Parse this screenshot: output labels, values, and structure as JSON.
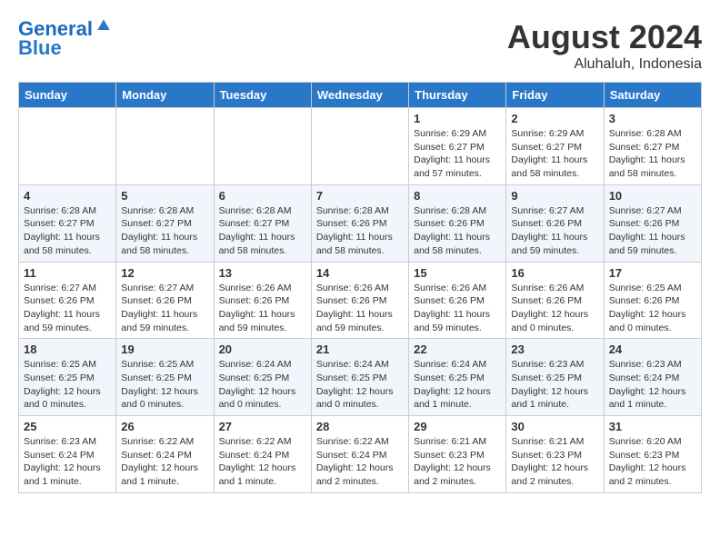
{
  "header": {
    "logo_line1": "General",
    "logo_line2": "Blue",
    "month_year": "August 2024",
    "location": "Aluhaluh, Indonesia"
  },
  "weekdays": [
    "Sunday",
    "Monday",
    "Tuesday",
    "Wednesday",
    "Thursday",
    "Friday",
    "Saturday"
  ],
  "weeks": [
    [
      {
        "day": "",
        "info": ""
      },
      {
        "day": "",
        "info": ""
      },
      {
        "day": "",
        "info": ""
      },
      {
        "day": "",
        "info": ""
      },
      {
        "day": "1",
        "info": "Sunrise: 6:29 AM\nSunset: 6:27 PM\nDaylight: 11 hours\nand 57 minutes."
      },
      {
        "day": "2",
        "info": "Sunrise: 6:29 AM\nSunset: 6:27 PM\nDaylight: 11 hours\nand 58 minutes."
      },
      {
        "day": "3",
        "info": "Sunrise: 6:28 AM\nSunset: 6:27 PM\nDaylight: 11 hours\nand 58 minutes."
      }
    ],
    [
      {
        "day": "4",
        "info": "Sunrise: 6:28 AM\nSunset: 6:27 PM\nDaylight: 11 hours\nand 58 minutes."
      },
      {
        "day": "5",
        "info": "Sunrise: 6:28 AM\nSunset: 6:27 PM\nDaylight: 11 hours\nand 58 minutes."
      },
      {
        "day": "6",
        "info": "Sunrise: 6:28 AM\nSunset: 6:27 PM\nDaylight: 11 hours\nand 58 minutes."
      },
      {
        "day": "7",
        "info": "Sunrise: 6:28 AM\nSunset: 6:26 PM\nDaylight: 11 hours\nand 58 minutes."
      },
      {
        "day": "8",
        "info": "Sunrise: 6:28 AM\nSunset: 6:26 PM\nDaylight: 11 hours\nand 58 minutes."
      },
      {
        "day": "9",
        "info": "Sunrise: 6:27 AM\nSunset: 6:26 PM\nDaylight: 11 hours\nand 59 minutes."
      },
      {
        "day": "10",
        "info": "Sunrise: 6:27 AM\nSunset: 6:26 PM\nDaylight: 11 hours\nand 59 minutes."
      }
    ],
    [
      {
        "day": "11",
        "info": "Sunrise: 6:27 AM\nSunset: 6:26 PM\nDaylight: 11 hours\nand 59 minutes."
      },
      {
        "day": "12",
        "info": "Sunrise: 6:27 AM\nSunset: 6:26 PM\nDaylight: 11 hours\nand 59 minutes."
      },
      {
        "day": "13",
        "info": "Sunrise: 6:26 AM\nSunset: 6:26 PM\nDaylight: 11 hours\nand 59 minutes."
      },
      {
        "day": "14",
        "info": "Sunrise: 6:26 AM\nSunset: 6:26 PM\nDaylight: 11 hours\nand 59 minutes."
      },
      {
        "day": "15",
        "info": "Sunrise: 6:26 AM\nSunset: 6:26 PM\nDaylight: 11 hours\nand 59 minutes."
      },
      {
        "day": "16",
        "info": "Sunrise: 6:26 AM\nSunset: 6:26 PM\nDaylight: 12 hours\nand 0 minutes."
      },
      {
        "day": "17",
        "info": "Sunrise: 6:25 AM\nSunset: 6:26 PM\nDaylight: 12 hours\nand 0 minutes."
      }
    ],
    [
      {
        "day": "18",
        "info": "Sunrise: 6:25 AM\nSunset: 6:25 PM\nDaylight: 12 hours\nand 0 minutes."
      },
      {
        "day": "19",
        "info": "Sunrise: 6:25 AM\nSunset: 6:25 PM\nDaylight: 12 hours\nand 0 minutes."
      },
      {
        "day": "20",
        "info": "Sunrise: 6:24 AM\nSunset: 6:25 PM\nDaylight: 12 hours\nand 0 minutes."
      },
      {
        "day": "21",
        "info": "Sunrise: 6:24 AM\nSunset: 6:25 PM\nDaylight: 12 hours\nand 0 minutes."
      },
      {
        "day": "22",
        "info": "Sunrise: 6:24 AM\nSunset: 6:25 PM\nDaylight: 12 hours\nand 1 minute."
      },
      {
        "day": "23",
        "info": "Sunrise: 6:23 AM\nSunset: 6:25 PM\nDaylight: 12 hours\nand 1 minute."
      },
      {
        "day": "24",
        "info": "Sunrise: 6:23 AM\nSunset: 6:24 PM\nDaylight: 12 hours\nand 1 minute."
      }
    ],
    [
      {
        "day": "25",
        "info": "Sunrise: 6:23 AM\nSunset: 6:24 PM\nDaylight: 12 hours\nand 1 minute."
      },
      {
        "day": "26",
        "info": "Sunrise: 6:22 AM\nSunset: 6:24 PM\nDaylight: 12 hours\nand 1 minute."
      },
      {
        "day": "27",
        "info": "Sunrise: 6:22 AM\nSunset: 6:24 PM\nDaylight: 12 hours\nand 1 minute."
      },
      {
        "day": "28",
        "info": "Sunrise: 6:22 AM\nSunset: 6:24 PM\nDaylight: 12 hours\nand 2 minutes."
      },
      {
        "day": "29",
        "info": "Sunrise: 6:21 AM\nSunset: 6:23 PM\nDaylight: 12 hours\nand 2 minutes."
      },
      {
        "day": "30",
        "info": "Sunrise: 6:21 AM\nSunset: 6:23 PM\nDaylight: 12 hours\nand 2 minutes."
      },
      {
        "day": "31",
        "info": "Sunrise: 6:20 AM\nSunset: 6:23 PM\nDaylight: 12 hours\nand 2 minutes."
      }
    ]
  ]
}
